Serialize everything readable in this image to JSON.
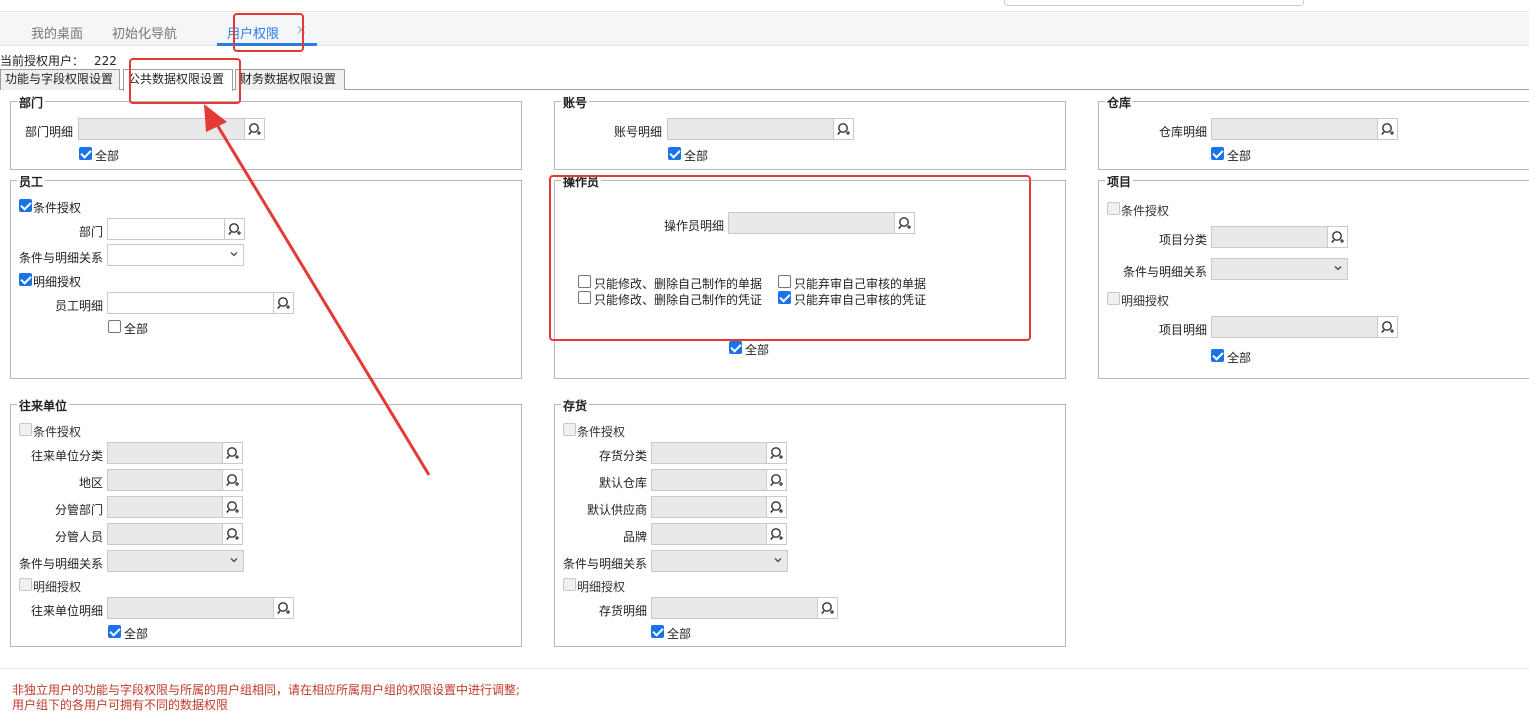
{
  "tabs": [
    {
      "label": "我的桌面"
    },
    {
      "label": "初始化导航"
    },
    {
      "label": "用户权限"
    }
  ],
  "tab_close": "×",
  "current_user_label": "当前授权用户：",
  "current_user_value": "222",
  "subtabs": [
    {
      "label": "功能与字段权限设置"
    },
    {
      "label": "公共数据权限设置"
    },
    {
      "label": "财务数据权限设置"
    }
  ],
  "dept": {
    "title": "部门",
    "detail_label": "部门明细",
    "all_label": "全部",
    "all_checked": true
  },
  "account": {
    "title": "账号",
    "detail_label": "账号明细",
    "all_label": "全部",
    "all_checked": true
  },
  "warehouse": {
    "title": "仓库",
    "detail_label": "仓库明细",
    "all_label": "全部",
    "all_checked": true
  },
  "employee": {
    "title": "员工",
    "cond_label": "条件授权",
    "cond_checked": true,
    "dept_label": "部门",
    "relation_label": "条件与明细关系",
    "detail_auth_label": "明细授权",
    "detail_auth_checked": true,
    "detail_label": "员工明细",
    "all_label": "全部",
    "all_checked": false
  },
  "operator": {
    "title": "操作员",
    "detail_label": "操作员明细",
    "opt1": "只能修改、删除自己制作的单据",
    "opt1_checked": false,
    "opt2": "只能修改、删除自己制作的凭证",
    "opt2_checked": false,
    "opt3": "只能弃审自己审核的单据",
    "opt3_checked": false,
    "opt4": "只能弃审自己审核的凭证",
    "opt4_checked": true,
    "all_label": "全部",
    "all_checked": true
  },
  "project": {
    "title": "项目",
    "cond_label": "条件授权",
    "category_label": "项目分类",
    "relation_label": "条件与明细关系",
    "detail_auth_label": "明细授权",
    "detail_label": "项目明细",
    "all_label": "全部",
    "all_checked": true
  },
  "partner": {
    "title": "往来单位",
    "cond_label": "条件授权",
    "category_label": "往来单位分类",
    "region_label": "地区",
    "dept_label": "分管部门",
    "person_label": "分管人员",
    "relation_label": "条件与明细关系",
    "detail_auth_label": "明细授权",
    "detail_label": "往来单位明细",
    "all_label": "全部",
    "all_checked": true
  },
  "inventory": {
    "title": "存货",
    "cond_label": "条件授权",
    "category_label": "存货分类",
    "warehouse_label": "默认仓库",
    "supplier_label": "默认供应商",
    "brand_label": "品牌",
    "relation_label": "条件与明细关系",
    "detail_auth_label": "明细授权",
    "detail_label": "存货明细",
    "all_label": "全部",
    "all_checked": true
  },
  "footer": {
    "line1": "非独立用户的功能与字段权限与所属的用户组相同，请在相应所属用户组的权限设置中进行调整;",
    "line2": "用户组下的各用户可拥有不同的数据权限"
  },
  "colors": {
    "accent": "#2c7be5",
    "annotation": "#e53935",
    "footer_text": "#c0392b"
  }
}
